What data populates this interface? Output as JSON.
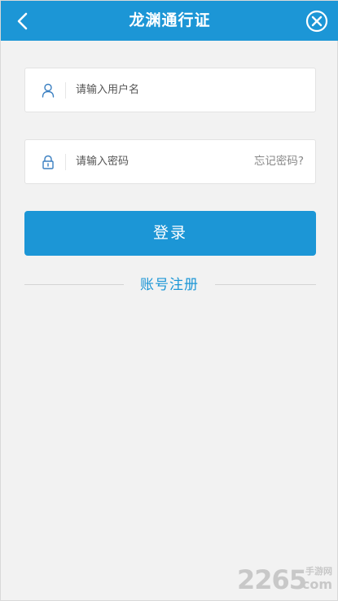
{
  "header": {
    "title": "龙渊通行证",
    "bg_color": "#1c96d6"
  },
  "form": {
    "username": {
      "placeholder": "请输入用户名",
      "icon": "user-icon"
    },
    "password": {
      "placeholder": "请输入密码",
      "icon": "lock-icon",
      "forgot_label": "忘记密码?"
    },
    "login_label": "登录",
    "register_label": "账号注册"
  },
  "watermark": {
    "brand": "2265",
    "site_top": "手游网",
    "site_bottom": ".com"
  }
}
